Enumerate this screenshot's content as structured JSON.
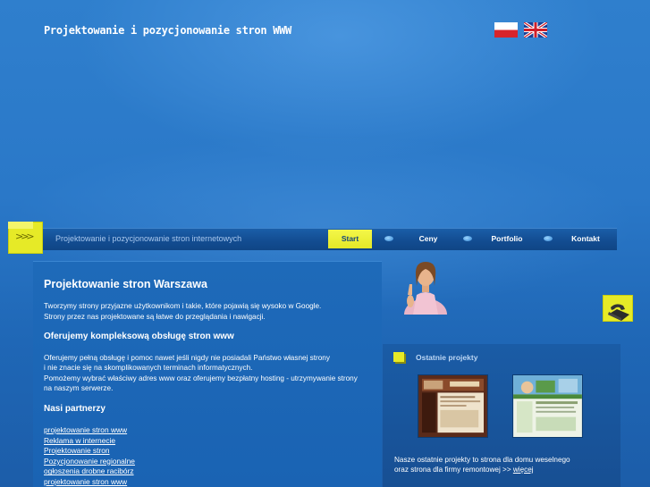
{
  "header": {
    "site_title": "Projektowanie i pozycjonowanie stron WWW"
  },
  "languages": [
    {
      "name": "pl-flag-icon"
    },
    {
      "name": "uk-flag-icon"
    }
  ],
  "nav": {
    "tagline": "Projektowanie i pozycjonowanie stron internetowych",
    "items": [
      "Start",
      "Ceny",
      "Portfolio",
      "Kontakt"
    ],
    "active": "Start"
  },
  "content": {
    "title": "Projektowanie stron Warszawa",
    "intro_line1": "Tworzymy strony przyjazne użytkownikom i takie, które pojawią się wysoko w Google.",
    "intro_line2": "Strony przez nas projektowane są łatwe do przeglądania i nawigacji.",
    "service_heading": "Oferujemy kompleksową obsługę stron www",
    "service_line1": "Oferujemy pełną obsługę i pomoc nawet jeśli nigdy nie posiadali Państwo własnej strony",
    "service_line2": "i nie znacie się na skomplikowanych terminach informatycznych.",
    "service_line3": "Pomożemy wybrać właściwy adres www oraz oferujemy bezpłatny hosting - utrzymywanie strony",
    "service_line4": "na naszym serwerze.",
    "partners_heading": "Nasi partnerzy",
    "partners": [
      "projektowanie stron www",
      "Reklama w internecie",
      "Projektowanie stron",
      "Pozycjonowanie regionalne",
      "ogłoszenia drobne racibórz",
      "projektowanie stron www"
    ]
  },
  "projects": {
    "title": "Ostatnie projekty",
    "desc_line1": "Nasze ostatnie projekty to strona dla domu weselnego",
    "desc_line2": "oraz strona dla firmy remontowej >> ",
    "more_link": "więcej"
  },
  "colors": {
    "accent_yellow": "#e6ea27",
    "nav_bg": "#134d92",
    "panel_bg": "#1e6ab9"
  }
}
